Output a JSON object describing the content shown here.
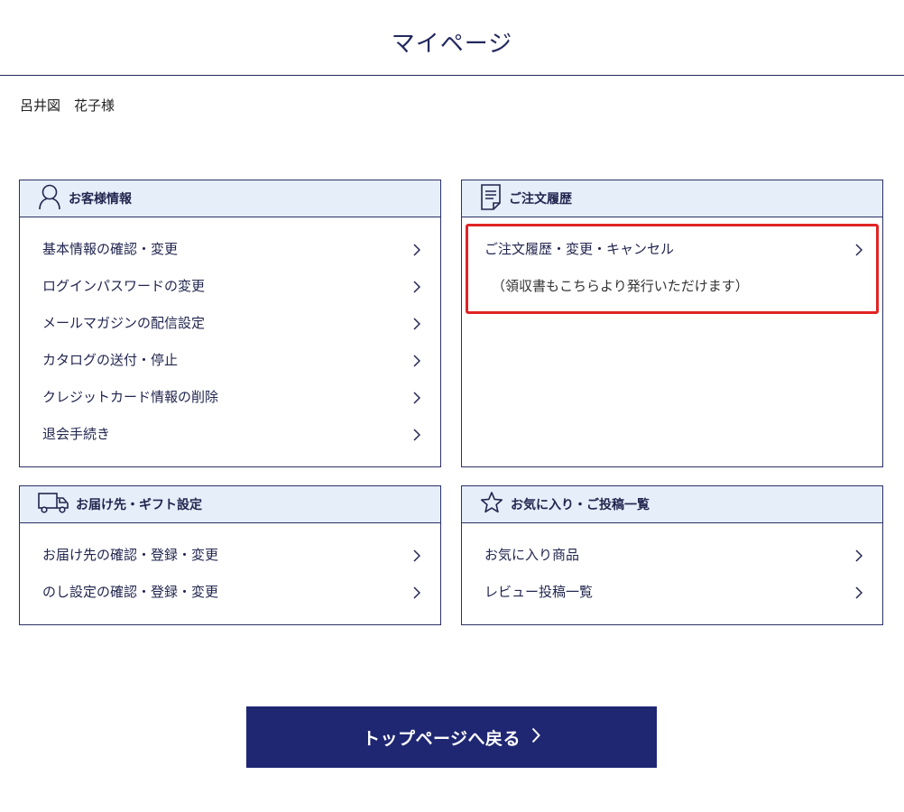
{
  "page": {
    "title": "マイページ"
  },
  "user": {
    "name": "呂井図　花子様"
  },
  "panels": {
    "customer": {
      "title": "お客様情報",
      "icon": "person-icon",
      "items": [
        "基本情報の確認・変更",
        "ログインパスワードの変更",
        "メールマガジンの配信設定",
        "カタログの送付・停止",
        "クレジットカード情報の削除",
        "退会手続き"
      ]
    },
    "orders": {
      "title": "ご注文履歴",
      "icon": "document-icon",
      "items": [
        "ご注文履歴・変更・キャンセル"
      ],
      "note": "（領収書もこちらより発行いただけます）"
    },
    "delivery": {
      "title": "お届け先・ギフト設定",
      "icon": "truck-icon",
      "items": [
        "お届け先の確認・登録・変更",
        "のし設定の確認・登録・変更"
      ]
    },
    "favorites": {
      "title": "お気に入り・ご投稿一覧",
      "icon": "star-icon",
      "items": [
        "お気に入り商品",
        "レビュー投稿一覧"
      ]
    }
  },
  "top_button": {
    "label": "トップページへ戻る"
  },
  "colors": {
    "navy": "#1f2773",
    "panel_header_bg": "#e5eef9",
    "highlight": "#e02424"
  }
}
